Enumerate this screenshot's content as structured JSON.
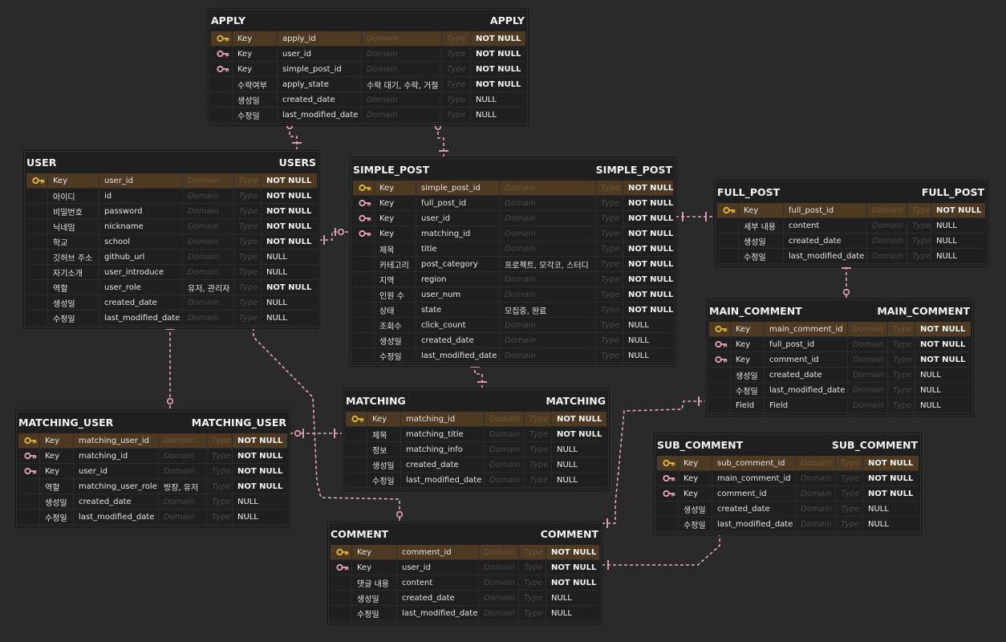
{
  "colors": {
    "background": "#2a2a2b",
    "entity_bg": "#1f1f20",
    "pk_row": "#4e3a23",
    "primary_key_icon": "#e2b93b",
    "foreign_key_icon": "#e7a6b8",
    "relation_line": "#e7a6b8"
  },
  "entities": {
    "apply": {
      "name": "APPLY",
      "table": "APPLY",
      "rows": [
        {
          "icon": "primary-key",
          "key": "Key",
          "column": "apply_id",
          "domain": "Domain",
          "type": "Type",
          "nullable": "NOT NULL"
        },
        {
          "icon": "foreign-key",
          "key": "Key",
          "column": "user_id",
          "domain": "Domain",
          "type": "Type",
          "nullable": "NOT NULL"
        },
        {
          "icon": "foreign-key",
          "key": "Key",
          "column": "simple_post_id",
          "domain": "Domain",
          "type": "Type",
          "nullable": "NOT NULL"
        },
        {
          "icon": "",
          "key": "수락여부",
          "column": "apply_state",
          "domain": "수락 대기, 수락, 거절",
          "type": "Type",
          "nullable": "NOT NULL"
        },
        {
          "icon": "",
          "key": "생성일",
          "column": "created_date",
          "domain": "Domain",
          "type": "Type",
          "nullable": "NULL"
        },
        {
          "icon": "",
          "key": "수정일",
          "column": "last_modified_date",
          "domain": "Domain",
          "type": "Type",
          "nullable": "NULL"
        }
      ]
    },
    "user": {
      "name": "USER",
      "table": "USERS",
      "rows": [
        {
          "icon": "primary-key",
          "key": "Key",
          "column": "user_id",
          "domain": "Domain",
          "type": "Type",
          "nullable": "NOT NULL"
        },
        {
          "icon": "",
          "key": "아이디",
          "column": "id",
          "domain": "Domain",
          "type": "Type",
          "nullable": "NOT NULL"
        },
        {
          "icon": "",
          "key": "비밀번호",
          "column": "password",
          "domain": "Domain",
          "type": "Type",
          "nullable": "NOT NULL"
        },
        {
          "icon": "",
          "key": "닉네임",
          "column": "nickname",
          "domain": "Domain",
          "type": "Type",
          "nullable": "NOT NULL"
        },
        {
          "icon": "",
          "key": "학교",
          "column": "school",
          "domain": "Domain",
          "type": "Type",
          "nullable": "NOT NULL"
        },
        {
          "icon": "",
          "key": "깃허브 주소",
          "column": "github_url",
          "domain": "Domain",
          "type": "Type",
          "nullable": "NULL"
        },
        {
          "icon": "",
          "key": "자기소개",
          "column": "user_introduce",
          "domain": "Domain",
          "type": "Type",
          "nullable": "NULL"
        },
        {
          "icon": "",
          "key": "역할",
          "column": "user_role",
          "domain": "유저, 관리자",
          "type": "Type",
          "nullable": "NOT NULL"
        },
        {
          "icon": "",
          "key": "생성일",
          "column": "created_date",
          "domain": "Domain",
          "type": "Type",
          "nullable": "NULL"
        },
        {
          "icon": "",
          "key": "수정일",
          "column": "last_modified_date",
          "domain": "Domain",
          "type": "Type",
          "nullable": "NULL"
        }
      ]
    },
    "simple_post": {
      "name": "SIMPLE_POST",
      "table": "SIMPLE_POST",
      "rows": [
        {
          "icon": "primary-key",
          "key": "Key",
          "column": "simple_post_id",
          "domain": "Domain",
          "type": "Type",
          "nullable": "NOT NULL"
        },
        {
          "icon": "foreign-key",
          "key": "Key",
          "column": "full_post_id",
          "domain": "Domain",
          "type": "Type",
          "nullable": "NOT NULL"
        },
        {
          "icon": "foreign-key",
          "key": "Key",
          "column": "user_id",
          "domain": "Domain",
          "type": "Type",
          "nullable": "NOT NULL"
        },
        {
          "icon": "foreign-key",
          "key": "Key",
          "column": "matching_id",
          "domain": "Domain",
          "type": "Type",
          "nullable": "NOT NULL"
        },
        {
          "icon": "",
          "key": "제목",
          "column": "title",
          "domain": "Domain",
          "type": "Type",
          "nullable": "NOT NULL"
        },
        {
          "icon": "",
          "key": "카테고리",
          "column": "post_category",
          "domain": "프로젝트, 모각코, 스터디",
          "type": "Type",
          "nullable": "NOT NULL"
        },
        {
          "icon": "",
          "key": "지역",
          "column": "region",
          "domain": "Domain",
          "type": "Type",
          "nullable": "NOT NULL"
        },
        {
          "icon": "",
          "key": "인원 수",
          "column": "user_num",
          "domain": "Domain",
          "type": "Type",
          "nullable": "NOT NULL"
        },
        {
          "icon": "",
          "key": "상태",
          "column": "state",
          "domain": "모집중, 완료",
          "type": "Type",
          "nullable": "NOT NULL"
        },
        {
          "icon": "",
          "key": "조회수",
          "column": "click_count",
          "domain": "Domain",
          "type": "Type",
          "nullable": "NULL"
        },
        {
          "icon": "",
          "key": "생성일",
          "column": "created_date",
          "domain": "Domain",
          "type": "Type",
          "nullable": "NULL"
        },
        {
          "icon": "",
          "key": "수정일",
          "column": "last_modified_date",
          "domain": "Domain",
          "type": "Type",
          "nullable": "NULL"
        }
      ]
    },
    "full_post": {
      "name": "FULL_POST",
      "table": "FULL_POST",
      "rows": [
        {
          "icon": "primary-key",
          "key": "Key",
          "column": "full_post_id",
          "domain": "Domain",
          "type": "Type",
          "nullable": "NOT NULL"
        },
        {
          "icon": "",
          "key": "세부 내용",
          "column": "content",
          "domain": "Domain",
          "type": "Type",
          "nullable": "NULL"
        },
        {
          "icon": "",
          "key": "생성일",
          "column": "created_date",
          "domain": "Domain",
          "type": "Type",
          "nullable": "NULL"
        },
        {
          "icon": "",
          "key": "수정일",
          "column": "last_modified_date",
          "domain": "Domain",
          "type": "Type",
          "nullable": "NULL"
        }
      ]
    },
    "main_comment": {
      "name": "MAIN_COMMENT",
      "table": "MAIN_COMMENT",
      "rows": [
        {
          "icon": "primary-key",
          "key": "Key",
          "column": "main_comment_id",
          "domain": "Domain",
          "type": "Type",
          "nullable": "NOT NULL"
        },
        {
          "icon": "foreign-key",
          "key": "Key",
          "column": "full_post_id",
          "domain": "Domain",
          "type": "Type",
          "nullable": "NOT NULL"
        },
        {
          "icon": "foreign-key",
          "key": "Key",
          "column": "comment_id",
          "domain": "Domain",
          "type": "Type",
          "nullable": "NOT NULL"
        },
        {
          "icon": "",
          "key": "생성일",
          "column": "created_date",
          "domain": "Domain",
          "type": "Type",
          "nullable": "NULL"
        },
        {
          "icon": "",
          "key": "수정일",
          "column": "last_modified_date",
          "domain": "Domain",
          "type": "Type",
          "nullable": "NULL"
        },
        {
          "icon": "",
          "key": "Field",
          "column": "Field",
          "domain": "Domain",
          "type": "Type",
          "nullable": "NULL"
        }
      ]
    },
    "matching": {
      "name": "MATCHING",
      "table": "MATCHING",
      "rows": [
        {
          "icon": "primary-key",
          "key": "Key",
          "column": "matching_id",
          "domain": "Domain",
          "type": "Type",
          "nullable": "NOT NULL"
        },
        {
          "icon": "",
          "key": "제목",
          "column": "matching_title",
          "domain": "Domain",
          "type": "Type",
          "nullable": "NOT NULL"
        },
        {
          "icon": "",
          "key": "정보",
          "column": "matching_info",
          "domain": "Domain",
          "type": "Type",
          "nullable": "NULL"
        },
        {
          "icon": "",
          "key": "생성일",
          "column": "created_date",
          "domain": "Domain",
          "type": "Type",
          "nullable": "NULL"
        },
        {
          "icon": "",
          "key": "수정일",
          "column": "last_modified_date",
          "domain": "Domain",
          "type": "Type",
          "nullable": "NULL"
        }
      ]
    },
    "matching_user": {
      "name": "MATCHING_USER",
      "table": "MATCHING_USER",
      "rows": [
        {
          "icon": "primary-key",
          "key": "Key",
          "column": "matching_user_id",
          "domain": "Domain",
          "type": "Type",
          "nullable": "NOT NULL"
        },
        {
          "icon": "foreign-key",
          "key": "Key",
          "column": "matching_id",
          "domain": "Domain",
          "type": "Type",
          "nullable": "NOT NULL"
        },
        {
          "icon": "foreign-key",
          "key": "Key",
          "column": "user_id",
          "domain": "Domain",
          "type": "Type",
          "nullable": "NOT NULL"
        },
        {
          "icon": "",
          "key": "역할",
          "column": "matching_user_role",
          "domain": "방장, 유저",
          "type": "Type",
          "nullable": "NOT NULL"
        },
        {
          "icon": "",
          "key": "생성일",
          "column": "created_date",
          "domain": "Domain",
          "type": "Type",
          "nullable": "NULL"
        },
        {
          "icon": "",
          "key": "수정일",
          "column": "last_modified_date",
          "domain": "Domain",
          "type": "Type",
          "nullable": "NULL"
        }
      ]
    },
    "sub_comment": {
      "name": "SUB_COMMENT",
      "table": "SUB_COMMENT",
      "rows": [
        {
          "icon": "primary-key",
          "key": "Key",
          "column": "sub_comment_id",
          "domain": "Domain",
          "type": "Type",
          "nullable": "NOT NULL"
        },
        {
          "icon": "foreign-key",
          "key": "Key",
          "column": "main_comment_id",
          "domain": "Domain",
          "type": "Type",
          "nullable": "NOT NULL"
        },
        {
          "icon": "foreign-key",
          "key": "Key",
          "column": "comment_id",
          "domain": "Domain",
          "type": "Type",
          "nullable": "NOT NULL"
        },
        {
          "icon": "",
          "key": "생성일",
          "column": "created_date",
          "domain": "Domain",
          "type": "Type",
          "nullable": "NULL"
        },
        {
          "icon": "",
          "key": "수정일",
          "column": "last_modified_date",
          "domain": "Domain",
          "type": "Type",
          "nullable": "NULL"
        }
      ]
    },
    "comment": {
      "name": "COMMENT",
      "table": "COMMENT",
      "rows": [
        {
          "icon": "primary-key",
          "key": "Key",
          "column": "comment_id",
          "domain": "Domain",
          "type": "Type",
          "nullable": "NOT NULL"
        },
        {
          "icon": "foreign-key",
          "key": "Key",
          "column": "user_id",
          "domain": "Domain",
          "type": "Type",
          "nullable": "NOT NULL"
        },
        {
          "icon": "",
          "key": "댓글 내용",
          "column": "content",
          "domain": "Domain",
          "type": "Type",
          "nullable": "NOT NULL"
        },
        {
          "icon": "",
          "key": "생성일",
          "column": "created_date",
          "domain": "Domain",
          "type": "Type",
          "nullable": "NULL"
        },
        {
          "icon": "",
          "key": "수정일",
          "column": "last_modified_date",
          "domain": "Domain",
          "type": "Type",
          "nullable": "NULL"
        }
      ]
    }
  }
}
